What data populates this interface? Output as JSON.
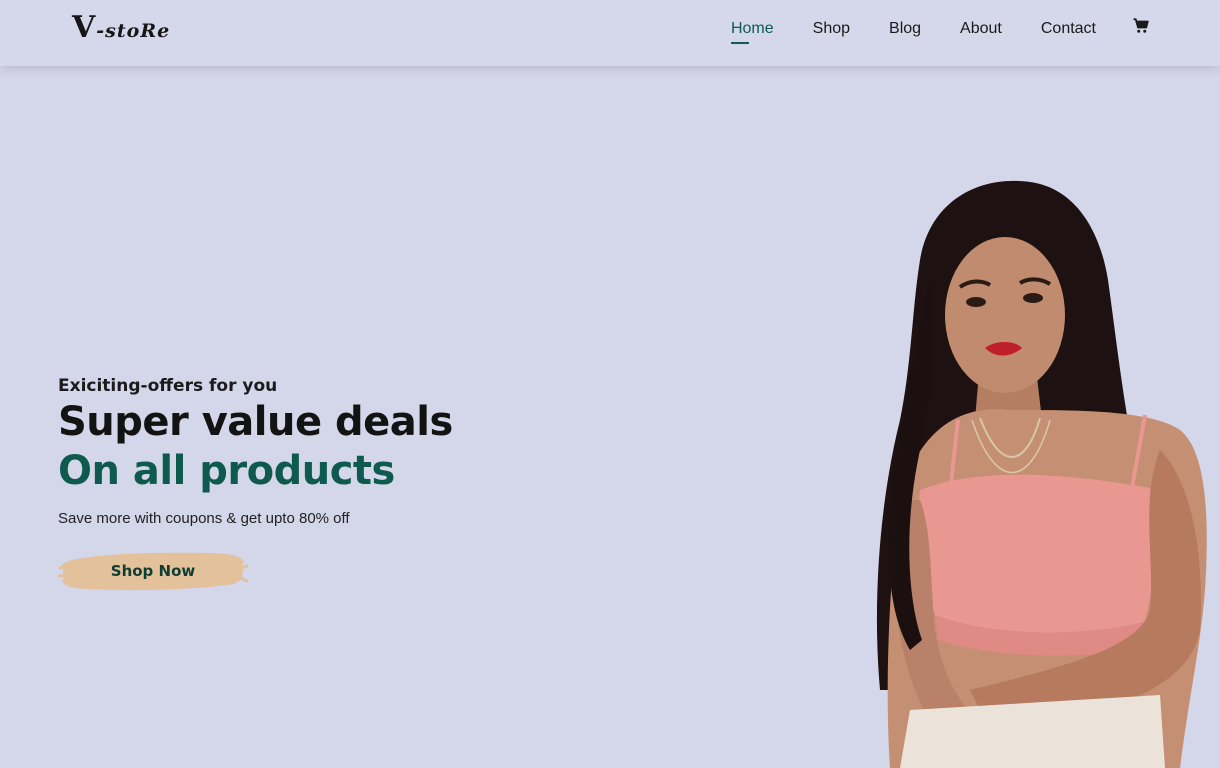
{
  "header": {
    "logo": {
      "main": "V",
      "small": "-stoRe"
    },
    "nav": [
      {
        "label": "Home",
        "active": true
      },
      {
        "label": "Shop",
        "active": false
      },
      {
        "label": "Blog",
        "active": false
      },
      {
        "label": "About",
        "active": false
      },
      {
        "label": "Contact",
        "active": false
      }
    ],
    "cart_icon": "cart-icon"
  },
  "hero": {
    "kicker": "Exiciting-offers for you",
    "title": "Super value deals",
    "subtitle": "On all products",
    "description": "Save more with coupons & get upto 80% off",
    "button_label": "Shop Now"
  },
  "colors": {
    "background": "#d4d6ea",
    "accent": "#0e5a4e",
    "button_brush": "#e3c19b"
  }
}
